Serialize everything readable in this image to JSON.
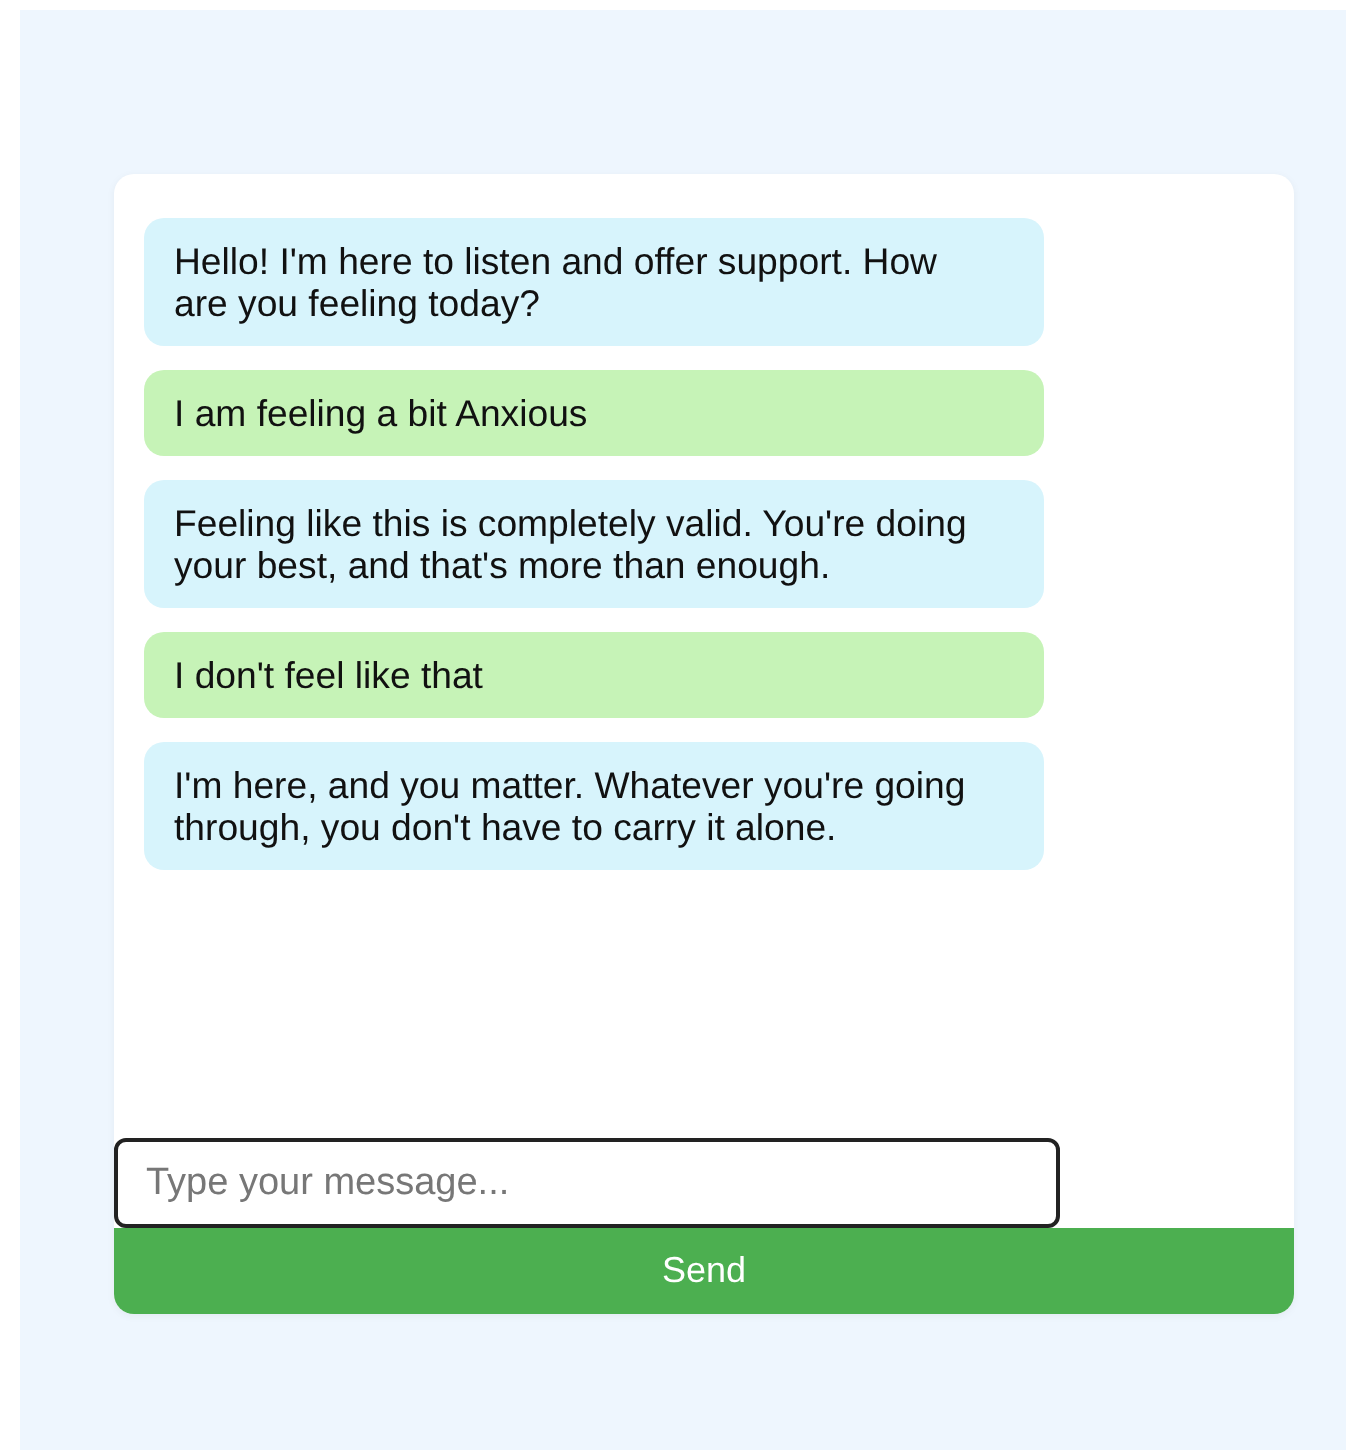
{
  "messages": [
    {
      "kind": "bot",
      "text": "Hello! I'm here to listen and offer support. How are you feeling today?"
    },
    {
      "kind": "user",
      "text": "I am feeling a bit Anxious"
    },
    {
      "kind": "bot",
      "text": "Feeling like this is completely valid. You're doing your best, and that's more than enough."
    },
    {
      "kind": "user",
      "text": "I don't feel like that"
    },
    {
      "kind": "bot",
      "text": "I'm here, and you matter. Whatever you're going through, you don't have to carry it alone."
    }
  ],
  "input": {
    "placeholder": "Type your message..."
  },
  "send_button": {
    "label": "Send"
  }
}
